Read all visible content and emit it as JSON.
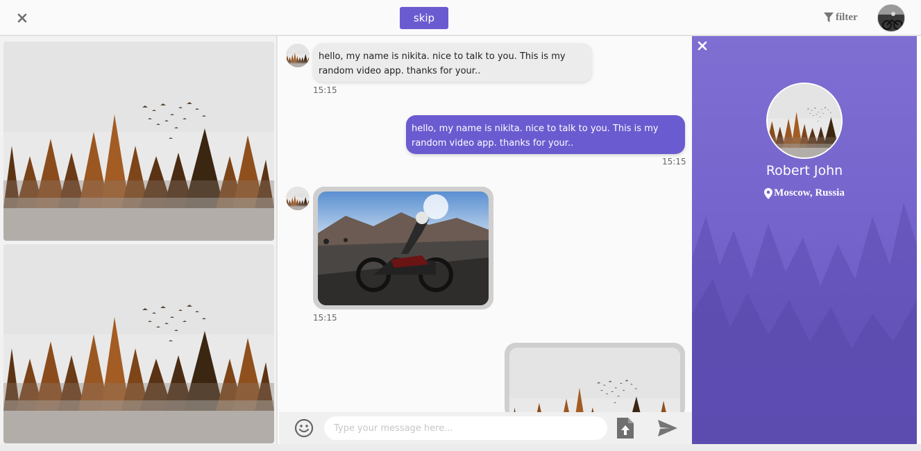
{
  "topbar": {
    "skip_label": "skip",
    "filter_label": "filter"
  },
  "chat": {
    "messages": [
      {
        "direction": "incoming",
        "text": "hello, my name is nikita. nice to talk to you. This is my random video app. thanks for your..",
        "time": "15:15"
      },
      {
        "direction": "outgoing",
        "text": "hello, my name is nikita. nice to talk to you. This is my random video app. thanks for your..",
        "time": "15:15"
      },
      {
        "direction": "incoming",
        "type": "image",
        "time": "15:15"
      }
    ]
  },
  "composer": {
    "placeholder": "Type your message here..."
  },
  "profile": {
    "name": "Robert John",
    "location": "Moscow, Russia"
  },
  "colors": {
    "accent": "#6b5bd0",
    "profile_bg": "#7463cb",
    "incoming_bubble": "#ececec"
  },
  "icons": [
    "close-icon",
    "filter-icon",
    "map-pin-icon",
    "emoji-icon",
    "file-upload-icon",
    "send-icon"
  ]
}
